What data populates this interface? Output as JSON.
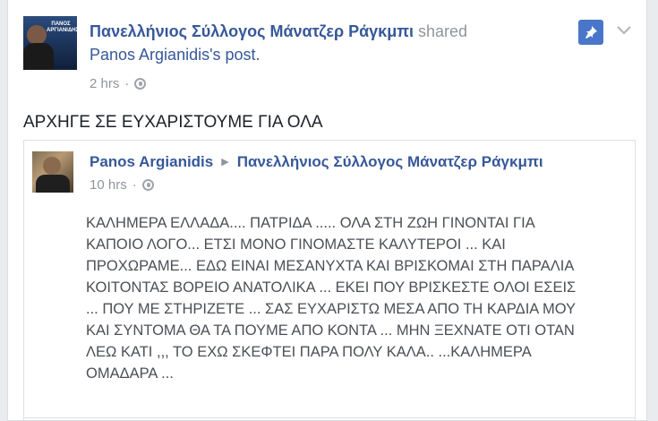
{
  "shared_post": {
    "page_name": "Πανελλήνιος Σύλλογος Μάνατζερ Ράγκμπι",
    "shared_label": "shared",
    "original_author_post": "Panos Argianidis",
    "post_suffix": "'s post.",
    "time": "2 hrs",
    "separator": "·",
    "avatar_text": "ΠΑΝΟΣ ΑΡΓΙΑΝΙΔΗΣ",
    "pin_icon": "pin-icon",
    "chevron_icon": "chevron-down-icon"
  },
  "message": "ΑΡΧΗΓΕ ΣΕ ΕΥΧΑΡΙΣΤΟΥΜΕ ΓΙΑ ΟΛΑ",
  "original_post": {
    "author": "Panos Argianidis",
    "arrow": "▶",
    "target_page": "Πανελλήνιος Σύλλογος Μάνατζερ Ράγκμπι",
    "time": "10 hrs",
    "separator": "·",
    "text": "ΚΑΛΗΜΕΡΑ ΕΛΛΑΔΑ.... ΠΑΤΡΙΔΑ ..... ΟΛΑ ΣΤΗ ΖΩΗ ΓΙΝΟΝΤΑΙ ΓΙΑ\nΚΑΠΟΙΟ ΛΟΓΟ... ΕΤΣΙ ΜΟΝΟ ΓΙΝΟΜΑΣΤΕ ΚΑΛΥΤΕΡΟΙ ... ΚΑΙ\nΠΡΟΧΩΡΑΜΕ... ΕΔΩ ΕΙΝΑΙ ΜΕΣΑΝΥΧΤΑ ΚΑΙ ΒΡΙΣΚΟΜΑΙ ΣΤΗ ΠΑΡΑΛΙΑ\nΚΟΙΤΟΝΤΑΣ ΒΟΡΕΙΟ ΑΝΑΤΟΛΙΚΑ ... ΕΚΕΙ ΠΟΥ ΒΡΙΣΚΕΣΤΕ ΟΛΟΙ ΕΣΕΙΣ\n... ΠΟΥ ΜΕ ΣΤΗΡΙΖΕΤΕ ... ΣΑΣ ΕΥΧΑΡΙΣΤΩ ΜΕΣΑ ΑΠΟ ΤΗ ΚΑΡΔΙΑ ΜΟΥ\nΚΑΙ ΣΥΝΤΟΜΑ ΘΑ ΤΑ ΠΟΥΜΕ ΑΠΟ ΚΟΝΤΑ ... ΜΗΝ ΞΕΧΝΑΤΕ ΟΤΙ ΟΤΑΝ\nΛΕΩ ΚΑΤΙ ,,, ΤΟ ΕΧΩ ΣΚΕΦΤΕΙ ΠΑΡΑ ΠΟΛΥ ΚΑΛΑ.. ...ΚΑΛΗΜΕΡΑ\nΟΜΑΔΑΡΑ ..."
  },
  "colors": {
    "link": "#365899",
    "meta": "#90949c",
    "body_text": "#4b4f56",
    "pin_button": "#4a76c9"
  }
}
